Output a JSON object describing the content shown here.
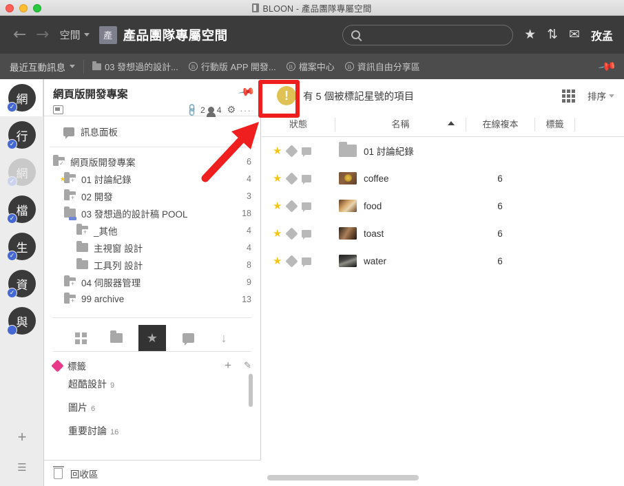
{
  "window": {
    "title": "BLOON - 產品團隊專屬空間"
  },
  "navbar": {
    "back_icon": "←",
    "forward_icon": "→",
    "breadcrumb_space": "空間",
    "space_badge": "產",
    "space_title": "產品團隊專屬空間",
    "search_placeholder": "",
    "search_value": "",
    "star_icon": "★",
    "sort_icon": "⇅",
    "mail_icon": "✉",
    "user": "孜孟"
  },
  "tabsbar": {
    "recent_label": "最近互動訊息",
    "tabs": [
      {
        "label": "03 發想過的設計...",
        "icon": "folder-icon"
      },
      {
        "label": "行動版 APP 開發...",
        "icon": "bloon-b-icon"
      },
      {
        "label": "檔案中心",
        "icon": "bloon-b-icon"
      },
      {
        "label": "資訊自由分享區",
        "icon": "bloon-b-icon"
      }
    ],
    "pin_icon": "📌"
  },
  "rail": {
    "items": [
      {
        "letter": "網",
        "state": "active",
        "badge": "check"
      },
      {
        "letter": "行",
        "state": "normal",
        "badge": "check"
      },
      {
        "letter": "網",
        "state": "dim",
        "badge": "check-dim"
      },
      {
        "letter": "檔",
        "state": "normal",
        "badge": "check"
      },
      {
        "letter": "生",
        "state": "normal",
        "badge": "check"
      },
      {
        "letter": "資",
        "state": "normal",
        "badge": "check"
      },
      {
        "letter": "與",
        "state": "normal",
        "badge": "dot"
      }
    ],
    "add_label": "+",
    "list_label": "☰"
  },
  "panel": {
    "title": "網頁版開發專案",
    "pin_icon": "📌",
    "monitor_icon": "monitor-icon",
    "link_count": "2",
    "people_count": "4",
    "gear_icon": "⚙",
    "more_icon": "···",
    "message_board": "訊息面板",
    "tree": [
      {
        "label": "網頁版開發專案",
        "count": "6",
        "indent": 0,
        "icon": "folder-check",
        "star": false
      },
      {
        "label": "01 討論紀錄",
        "count": "4",
        "indent": 1,
        "icon": "folder-plus",
        "star": true
      },
      {
        "label": "02 開發",
        "count": "3",
        "indent": 1,
        "icon": "folder-plus",
        "star": false
      },
      {
        "label": "03 發想過的設計稿 POOL",
        "count": "18",
        "indent": 1,
        "icon": "folder-open",
        "star": false
      },
      {
        "label": "_其他",
        "count": "4",
        "indent": 2,
        "icon": "folder-plus",
        "star": false
      },
      {
        "label": "主視窗 設計",
        "count": "4",
        "indent": 2,
        "icon": "folder",
        "star": false
      },
      {
        "label": "工具列 設計",
        "count": "8",
        "indent": 2,
        "icon": "folder",
        "star": false
      },
      {
        "label": "04 伺服器管理",
        "count": "9",
        "indent": 1,
        "icon": "folder-plus",
        "star": false
      },
      {
        "label": "99 archive",
        "count": "13",
        "indent": 1,
        "icon": "folder-plus",
        "star": false
      }
    ],
    "viewbar": [
      {
        "name": "grid-view-icon",
        "active": false
      },
      {
        "name": "folder-view-icon",
        "active": false
      },
      {
        "name": "star-view-icon",
        "active": true
      },
      {
        "name": "message-view-icon",
        "active": false
      },
      {
        "name": "download-view-icon",
        "active": false
      }
    ],
    "tags_header": "標籤",
    "tags_add": "+",
    "tags_edit": "✎",
    "tags": [
      {
        "label": "超酷設計",
        "count": "9"
      },
      {
        "label": "圖片",
        "count": "6"
      },
      {
        "label": "重要討論",
        "count": "16"
      }
    ],
    "trash_label": "回收區"
  },
  "main": {
    "notice_icon": "!",
    "notice_text": "有 5 個被標記星號的項目",
    "grid_icon": "grid-icon",
    "sort_label": "排序",
    "columns": {
      "status": "狀態",
      "name": "名稱",
      "online_copy": "在線複本",
      "tag": "標籤"
    },
    "sort_direction": "asc",
    "rows": [
      {
        "name": "01 討論紀錄",
        "online_copy": "",
        "thumb": "folder",
        "starred": true
      },
      {
        "name": "coffee",
        "online_copy": "6",
        "thumb": "coffee",
        "starred": true
      },
      {
        "name": "food",
        "online_copy": "6",
        "thumb": "food",
        "starred": true
      },
      {
        "name": "toast",
        "online_copy": "6",
        "thumb": "toast",
        "starred": true
      },
      {
        "name": "water",
        "online_copy": "6",
        "thumb": "water",
        "starred": true
      }
    ]
  },
  "annotation": {
    "highlight_color": "#f01f1f",
    "target": "notice-icon"
  }
}
